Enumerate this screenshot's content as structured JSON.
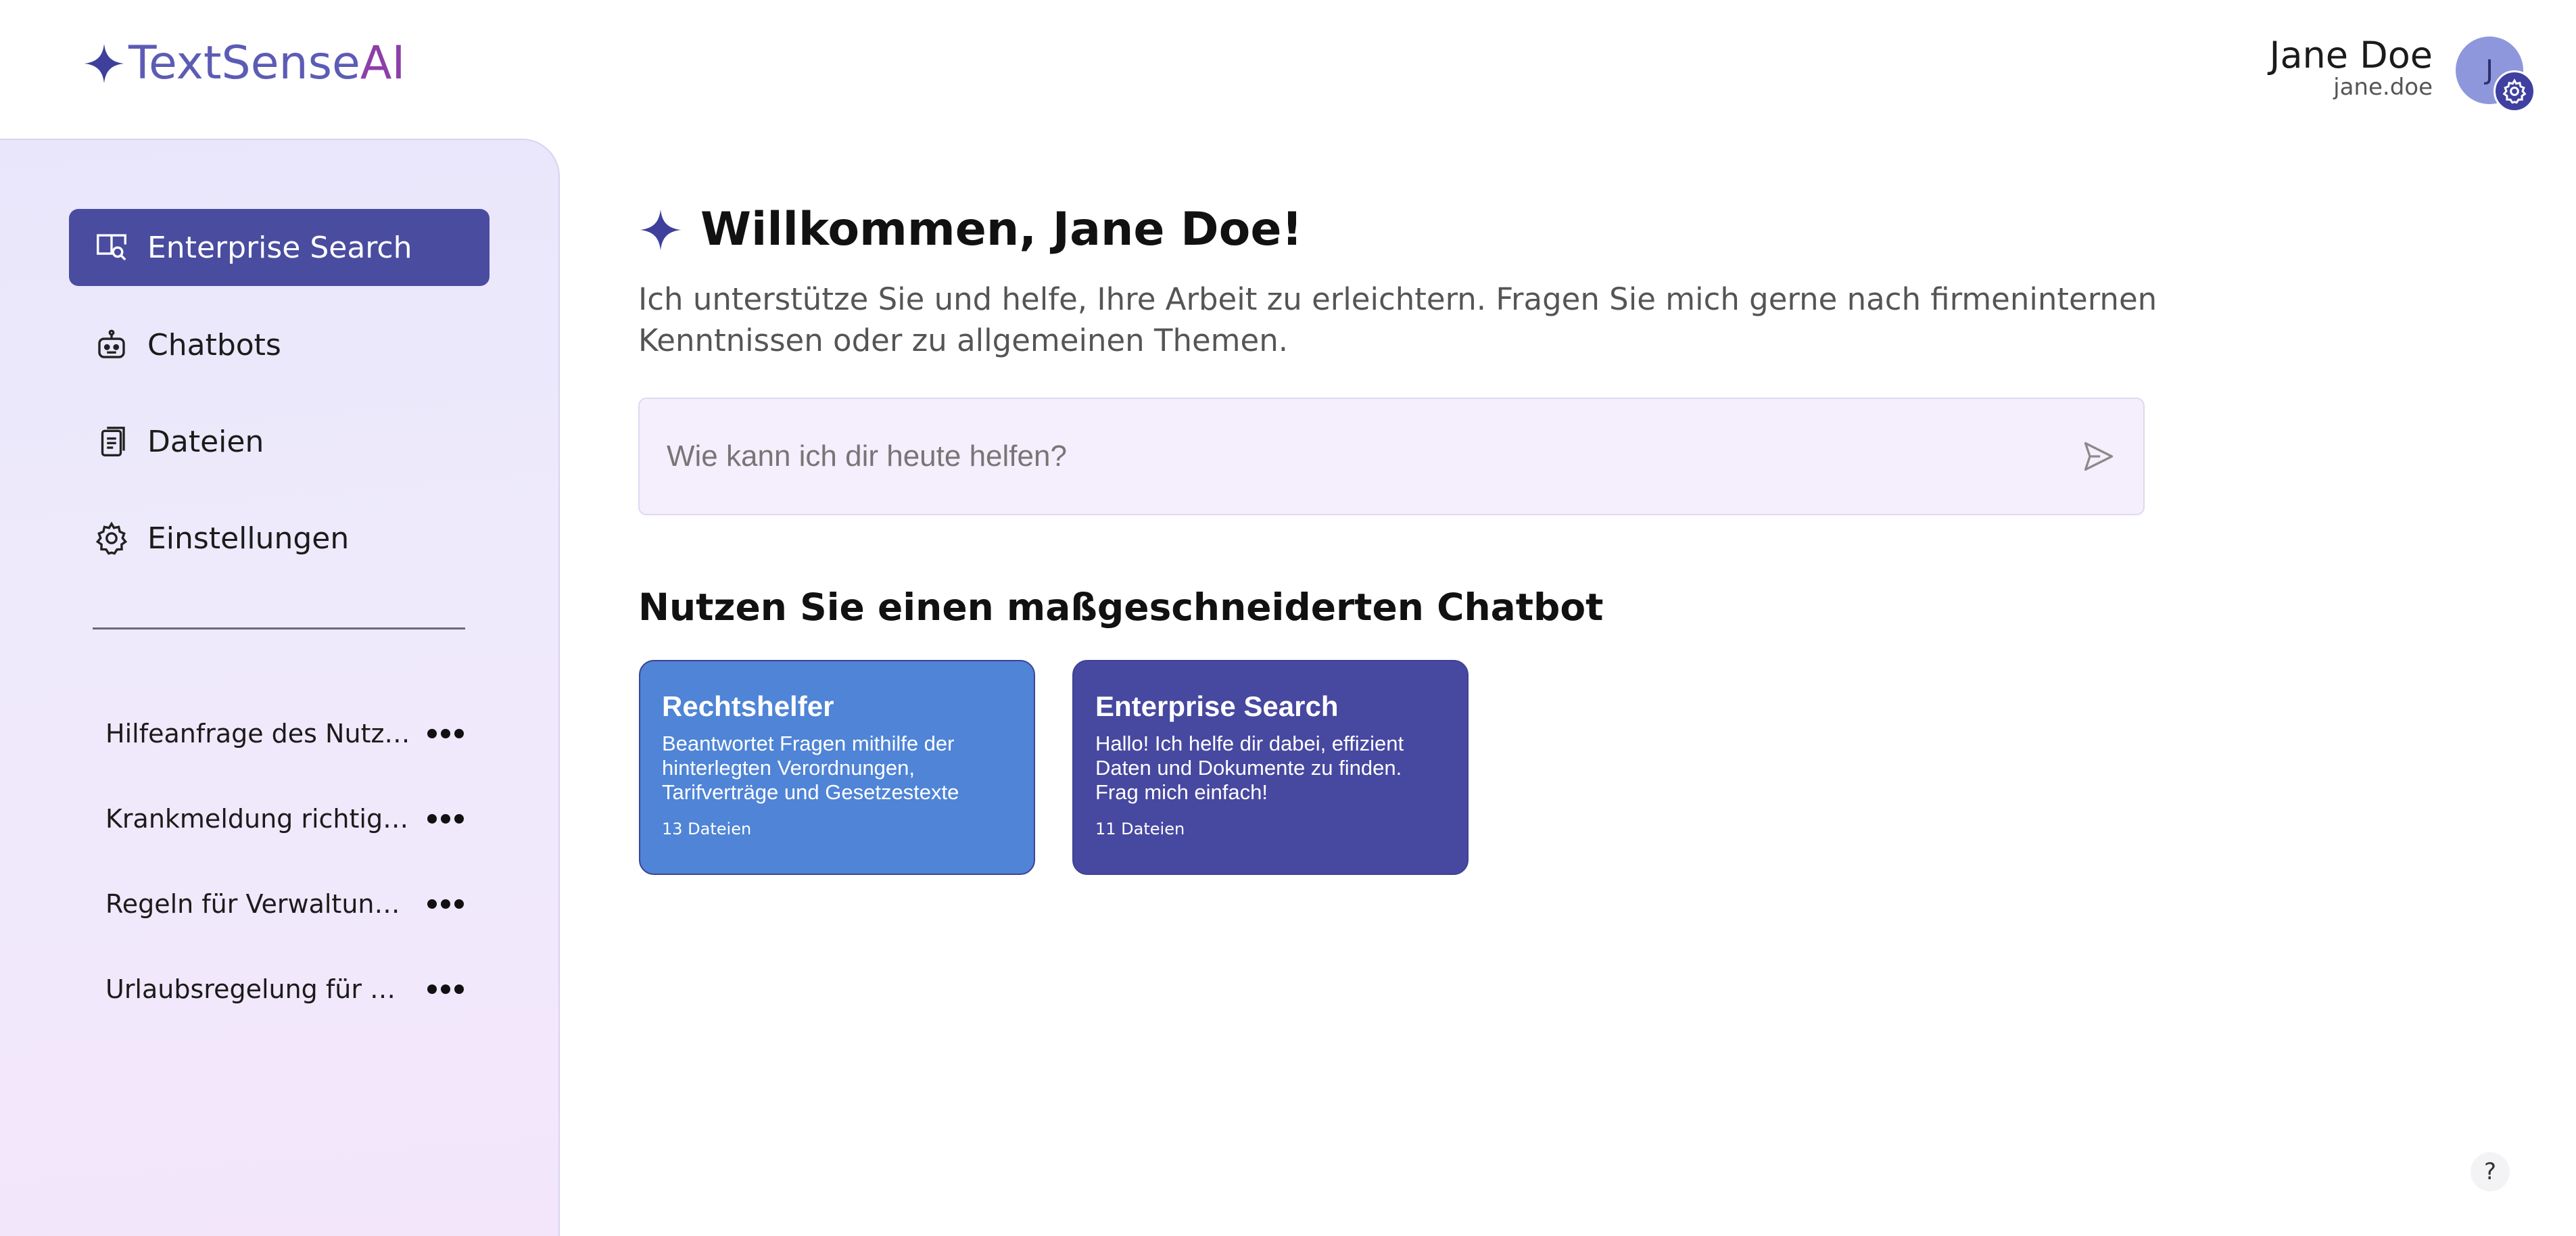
{
  "brand": {
    "name_main": "TextSense",
    "name_ai": "AI"
  },
  "user": {
    "name": "Jane Doe",
    "handle": "jane.doe",
    "initial": "J"
  },
  "sidebar": {
    "nav": [
      {
        "label": "Enterprise Search",
        "icon": "enterprise-search-icon",
        "active": true
      },
      {
        "label": "Chatbots",
        "icon": "robot-icon",
        "active": false
      },
      {
        "label": "Dateien",
        "icon": "files-icon",
        "active": false
      },
      {
        "label": "Einstellungen",
        "icon": "gear-icon",
        "active": false
      }
    ],
    "chats": [
      {
        "label": "Hilfeanfrage des Nutzers"
      },
      {
        "label": "Krankmeldung richtig durchführen"
      },
      {
        "label": "Regeln für Verwaltungsvorgänge"
      },
      {
        "label": "Urlaubsregelung für Uni-Mitarbeiter"
      }
    ]
  },
  "main": {
    "welcome_title": "Willkommen, Jane Doe!",
    "welcome_subtitle": "Ich unterstütze Sie und helfe, Ihre Arbeit zu erleichtern. Fragen Sie mich gerne nach firmeninternen Kenntnissen oder zu allgemeinen Themen.",
    "search_placeholder": "Wie kann ich dir heute helfen?",
    "section_title": "Nutzen Sie einen maßgeschneiderten Chatbot",
    "cards": [
      {
        "title": "Rechtshelfer",
        "description": "Beantwortet Fragen mithilfe der hinterlegten Verordnungen, Tarifverträge und Gesetzestexte",
        "files": "13 Dateien",
        "color": "#4f84d6"
      },
      {
        "title": "Enterprise Search",
        "description": "Hallo! Ich helfe dir dabei, effizient Daten und Dokumente zu finden. Frag mich einfach!",
        "files": "11 Dateien",
        "color": "#4748a0"
      }
    ]
  },
  "help": {
    "label": "?"
  },
  "colors": {
    "accent": "#4a4ca0",
    "brand_purple": "#8d3fa8",
    "sidebar_bg": "#ece8fb"
  }
}
